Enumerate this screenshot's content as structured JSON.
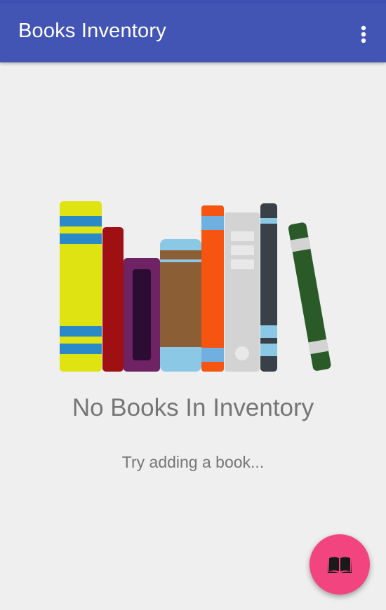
{
  "app_bar": {
    "title": "Books Inventory",
    "overflow_icon": "more-vert-icon",
    "color": "#4355b4"
  },
  "empty_state": {
    "illustration_icon": "bookshelf-illustration",
    "title": "No Books In Inventory",
    "subtitle": "Try adding a book..."
  },
  "fab": {
    "icon": "open-book-icon",
    "color": "#f2447e"
  }
}
